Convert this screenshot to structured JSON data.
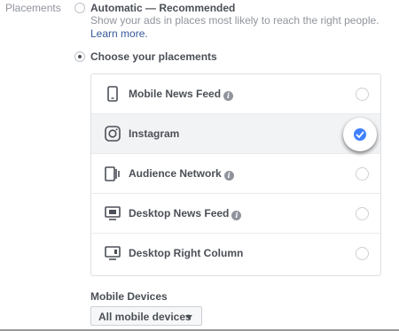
{
  "section": {
    "label": "Placements"
  },
  "automatic": {
    "title": "Automatic — Recommended",
    "description": "Show your ads in places most likely to reach the right people.",
    "learn_more": "Learn more.",
    "selected": false
  },
  "choose": {
    "title": "Choose your placements",
    "selected": true
  },
  "placements": [
    {
      "label": "Mobile News Feed",
      "icon": "mobile-phone-icon",
      "info": true,
      "checked": false
    },
    {
      "label": "Instagram",
      "icon": "instagram-icon",
      "info": false,
      "checked": true
    },
    {
      "label": "Audience Network",
      "icon": "audience-network-icon",
      "info": true,
      "checked": false
    },
    {
      "label": "Desktop News Feed",
      "icon": "desktop-monitor-icon",
      "info": true,
      "checked": false
    },
    {
      "label": "Desktop Right Column",
      "icon": "desktop-right-column-icon",
      "info": false,
      "checked": false
    }
  ],
  "devices": {
    "label": "Mobile Devices",
    "selected": "All mobile devices"
  },
  "colors": {
    "accent": "#4080ff",
    "link": "#365899",
    "text": "#4b4f56",
    "muted": "#90949c"
  }
}
